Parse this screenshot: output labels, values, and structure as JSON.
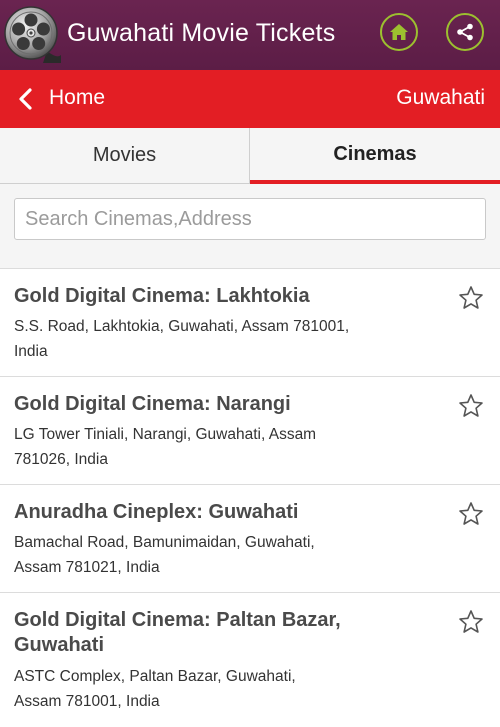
{
  "header": {
    "app_title": "Guwahati Movie Tickets",
    "logo_icon": "film-reel-icon",
    "home_icon": "home-icon",
    "share_icon": "share-icon",
    "background_color": "#5f1f49",
    "button_ring_color": "#9cc02f"
  },
  "nav": {
    "back_label": "Home",
    "back_icon": "chevron-left-icon",
    "city_label": "Guwahati",
    "background_color": "#e31e24"
  },
  "tabs": [
    {
      "label": "Movies",
      "selected": false
    },
    {
      "label": "Cinemas",
      "selected": true
    }
  ],
  "search": {
    "placeholder": "Search Cinemas,Address",
    "value": ""
  },
  "cinemas": [
    {
      "name": "Gold Digital Cinema: Lakhtokia",
      "address": "S.S. Road, Lakhtokia, Guwahati, Assam 781001, India",
      "favorite_icon": "star-outline-icon"
    },
    {
      "name": "Gold Digital Cinema: Narangi",
      "address": "LG Tower Tiniali, Narangi, Guwahati, Assam 781026, India",
      "favorite_icon": "star-outline-icon"
    },
    {
      "name": "Anuradha Cineplex: Guwahati",
      "address": "Bamachal Road, Bamunimaidan, Guwahati, Assam 781021, India",
      "favorite_icon": "star-outline-icon"
    },
    {
      "name": "Gold Digital Cinema: Paltan Bazar, Guwahati",
      "address": "ASTC Complex, Paltan Bazar, Guwahati, Assam 781001, India",
      "favorite_icon": "star-outline-icon"
    }
  ]
}
